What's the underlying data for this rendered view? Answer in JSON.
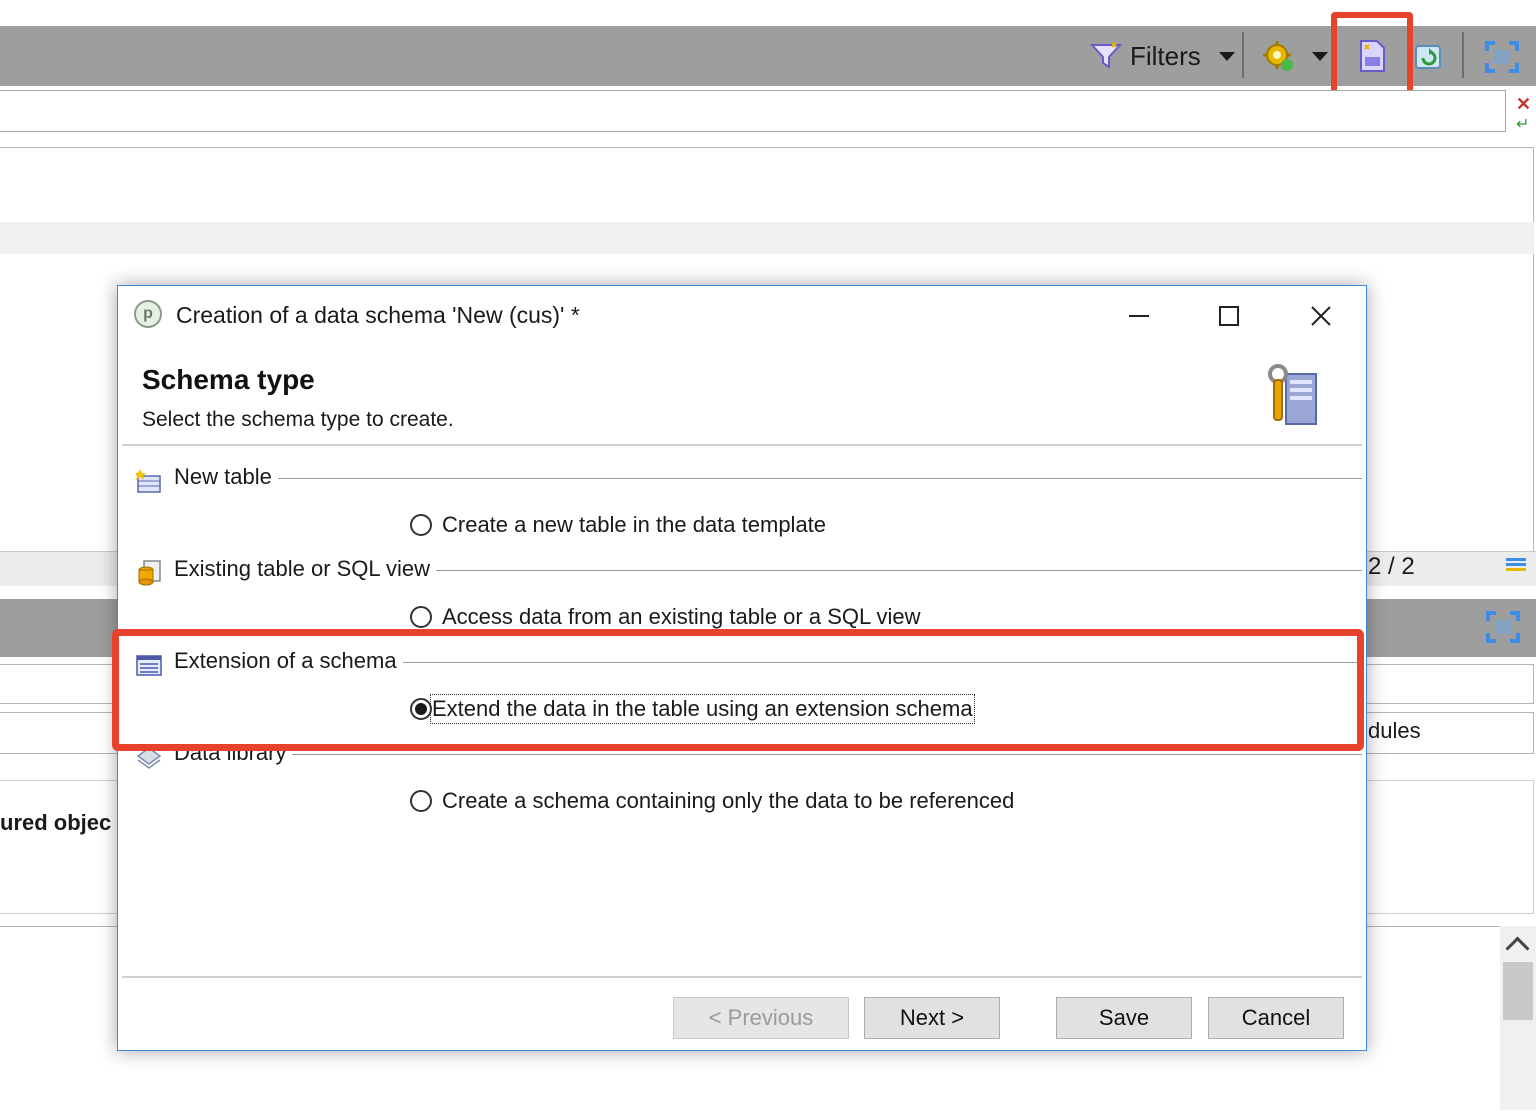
{
  "toolbar": {
    "filters_label": "Filters",
    "icons": [
      "filter-icon",
      "gear-new-icon",
      "new-document-icon",
      "refresh-icon",
      "maximize-icon"
    ]
  },
  "list": {
    "page_count": "2 / 2"
  },
  "detail": {
    "field_text": "dules",
    "label": "ured objec"
  },
  "dialog": {
    "title": "Creation of a data schema 'New (cus)' *",
    "heading": "Schema type",
    "subheading": "Select the schema type to create.",
    "sections": [
      {
        "label": "New table",
        "option": "Create a new table in the data template",
        "selected": false
      },
      {
        "label": "Existing table or SQL view",
        "option": "Access data from an existing table or a SQL view",
        "selected": false
      },
      {
        "label": "Extension of a schema",
        "option": "Extend the data in the table using an extension schema",
        "selected": true
      },
      {
        "label": "Data library",
        "option": "Create a schema containing only the data to be referenced",
        "selected": false
      }
    ],
    "buttons": {
      "previous": "< Previous",
      "next": "Next >",
      "save": "Save",
      "cancel": "Cancel"
    }
  },
  "colors": {
    "highlight": "#e8412c",
    "dialog_border": "#3c8ad8",
    "toolbar_bg": "#9e9e9e"
  }
}
